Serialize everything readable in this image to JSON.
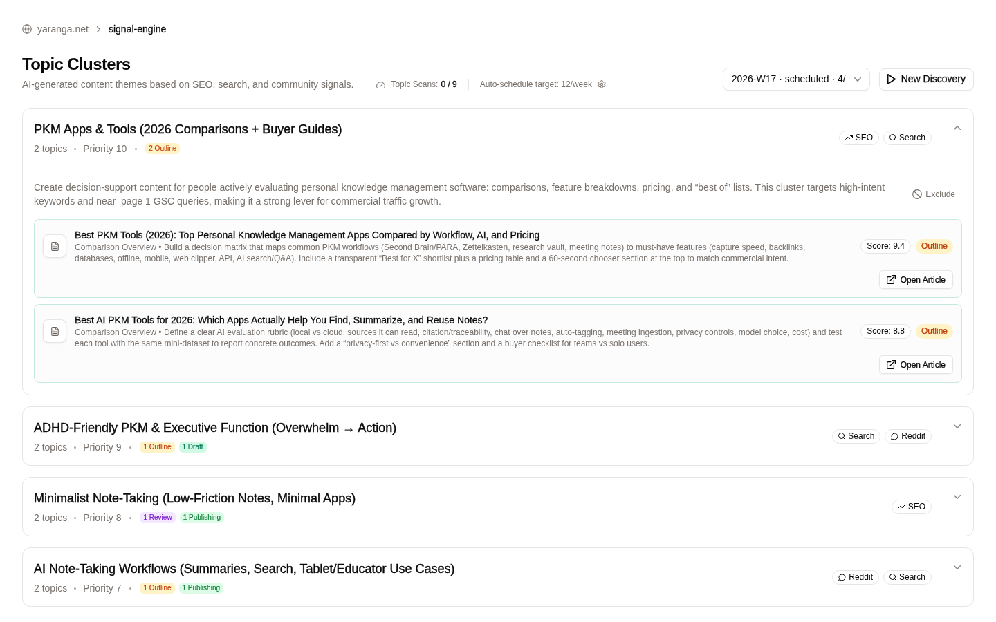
{
  "breadcrumb": [
    {
      "label": "yaranga.net",
      "current": false
    },
    {
      "label": "signal-engine",
      "current": true
    }
  ],
  "header": {
    "title": "Topic Clusters",
    "subtitle": "AI-generated content themes based on SEO, search, and community signals.",
    "scans": {
      "label": "Topic Scans:",
      "value": "0 / 9"
    },
    "schedule_target": "Auto-schedule target: 12/week"
  },
  "week_select": {
    "value": "2026-W17 · scheduled · 4/"
  },
  "new_button": "New Discovery",
  "clusters": [
    {
      "title": "PKM Apps & Tools (2026 Comparisons + Buyer Guides)",
      "topics": "2 topics",
      "priority": "Priority 10",
      "statuses": [
        {
          "label": "2 Outline",
          "kind": "outline"
        }
      ],
      "signals": [
        {
          "label": "SEO",
          "kind": "seo"
        },
        {
          "label": "Search",
          "kind": "search"
        }
      ],
      "expanded": true,
      "description": "Create decision-support content for people actively evaluating personal knowledge management software: comparisons, feature breakdowns, pricing, and “best of” lists. This cluster targets high-intent keywords and near–page 1 GSC queries, making it a strong lever for commercial traffic growth.",
      "exclude": "Exclude",
      "articles": [
        {
          "title": "Best PKM Tools (2026): Top Personal Knowledge Management Apps Compared by Workflow, AI, and Pricing",
          "summary": "Comparison Overview • Build a decision matrix that maps common PKM workflows (Second Brain/PARA, Zettelkasten, research vault, meeting notes) to must-have features (capture speed, backlinks, databases, offline, mobile, web clipper, API, AI search/Q&A). Include a transparent “Best for X” shortlist plus a pricing table and a 60-second chooser section at the top to match commercial intent.",
          "score": "Score: 9.4",
          "status": {
            "label": "Outline",
            "kind": "outline"
          },
          "action": "Open Article"
        },
        {
          "title": "Best AI PKM Tools for 2026: Which Apps Actually Help You Find, Summarize, and Reuse Notes?",
          "summary": "Comparison Overview • Define a clear AI evaluation rubric (local vs cloud, sources it can read, citation/traceability, chat over notes, auto-tagging, meeting ingestion, privacy controls, model choice, cost) and test each tool with the same mini-dataset to report concrete outcomes. Add a “privacy-first vs convenience” section and a buyer checklist for teams vs solo users.",
          "score": "Score: 8.8",
          "status": {
            "label": "Outline",
            "kind": "outline"
          },
          "action": "Open Article"
        }
      ]
    },
    {
      "title": "ADHD-Friendly PKM & Executive Function (Overwhelm → Action)",
      "topics": "2 topics",
      "priority": "Priority 9",
      "statuses": [
        {
          "label": "1 Outline",
          "kind": "outline"
        },
        {
          "label": "1 Draft",
          "kind": "draft"
        }
      ],
      "signals": [
        {
          "label": "Search",
          "kind": "search"
        },
        {
          "label": "Reddit",
          "kind": "reddit"
        }
      ],
      "expanded": false
    },
    {
      "title": "Minimalist Note-Taking (Low-Friction Notes, Minimal Apps)",
      "topics": "2 topics",
      "priority": "Priority 8",
      "statuses": [
        {
          "label": "1 Review",
          "kind": "review"
        },
        {
          "label": "1 Publishing",
          "kind": "publishing"
        }
      ],
      "signals": [
        {
          "label": "SEO",
          "kind": "seo"
        }
      ],
      "expanded": false
    },
    {
      "title": "AI Note-Taking Workflows (Summaries, Search, Tablet/Educator Use Cases)",
      "topics": "2 topics",
      "priority": "Priority 7",
      "statuses": [
        {
          "label": "1 Outline",
          "kind": "outline"
        },
        {
          "label": "1 Publishing",
          "kind": "publishing"
        }
      ],
      "signals": [
        {
          "label": "Reddit",
          "kind": "reddit"
        },
        {
          "label": "Search",
          "kind": "search"
        }
      ],
      "expanded": false
    }
  ]
}
